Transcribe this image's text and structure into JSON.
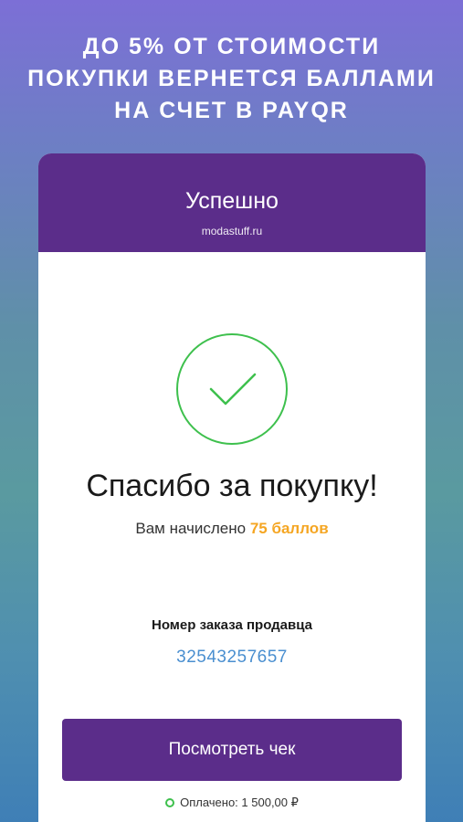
{
  "promo": {
    "lines": [
      "ДО 5% ОТ СТОИМОСТИ",
      "ПОКУПКИ ВЕРНЕТСЯ БАЛЛАМИ",
      "НА СЧЕТ В PAYQR"
    ]
  },
  "header": {
    "title": "Успешно",
    "merchant": "modastuff.ru"
  },
  "success": {
    "icon": "checkmark-circle-icon",
    "color": "#3ec04d"
  },
  "thanks": "Спасибо за покупку!",
  "bonus": {
    "prefix": "Вам начислено",
    "amount": "75 баллов"
  },
  "order": {
    "label": "Номер заказа продавца",
    "number": "32543257657"
  },
  "receipt_button": "Посмотреть чек",
  "paid": {
    "text": "Оплачено: 1 500,00 ₽"
  },
  "colors": {
    "brand": "#5b2d8a",
    "accent": "#f5a623",
    "link": "#4a8fd0",
    "success": "#3ec04d"
  }
}
